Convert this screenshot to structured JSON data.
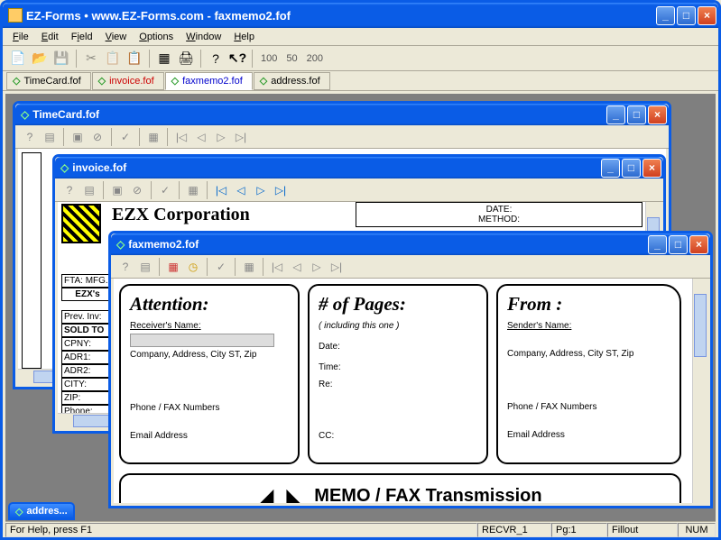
{
  "app": {
    "title": "EZ-Forms  •  www.EZ-Forms.com - faxmemo2.fof"
  },
  "menu": {
    "file": "File",
    "edit": "Edit",
    "field": "Field",
    "view": "View",
    "options": "Options",
    "window": "Window",
    "help": "Help"
  },
  "zoom": {
    "z1": "100",
    "z2": "50",
    "z3": "200"
  },
  "tabs": {
    "t1": "TimeCard.fof",
    "t2": "invoice.fof",
    "t3": "faxmemo2.fof",
    "t4": "address.fof"
  },
  "children": {
    "timecard": {
      "title": "TimeCard.fof"
    },
    "invoice": {
      "title": "invoice.fof",
      "company": "EZX Corporation",
      "date_lbl": "DATE:",
      "method_lbl": "METHOD:",
      "fta": "FTA: MFG.",
      "ezx": "EZX's",
      "prev": "Prev. Inv:",
      "soldto": "SOLD TO",
      "cpny": "CPNY:",
      "adr1": "ADR1:",
      "adr2": "ADR2:",
      "city": "CITY:",
      "zip": "ZIP:",
      "phone": "Phone:"
    },
    "fax": {
      "title": "faxmemo2.fof",
      "attention": {
        "head": "Attention:",
        "recv": "Receiver's Name:",
        "addr": "Company, Address, City ST, Zip",
        "phone": "Phone / FAX Numbers",
        "email": "Email Address"
      },
      "pages": {
        "head": "# of Pages:",
        "sub": "( including this one )",
        "date": "Date:",
        "time": "Time:",
        "re": "Re:",
        "cc": "CC:"
      },
      "from": {
        "head": "From :",
        "send": "Sender's Name:",
        "addr": "Company, Address, City ST, Zip",
        "phone": "Phone / FAX Numbers",
        "email": "Email Address"
      },
      "memo": "MEMO / FAX Transmission"
    },
    "address": {
      "title": "addres..."
    }
  },
  "status": {
    "help": "For Help, press F1",
    "recv": "RECVR_1",
    "pg": "Pg:1",
    "mode": "Fillout",
    "num": "NUM"
  }
}
